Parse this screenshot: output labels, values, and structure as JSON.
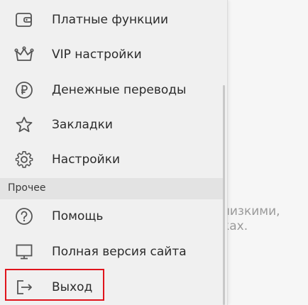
{
  "menu": {
    "items": [
      {
        "label": "Платные функции",
        "icon": "wallet-icon"
      },
      {
        "label": "VIP настройки",
        "icon": "crown-icon"
      },
      {
        "label": "Денежные переводы",
        "icon": "ruble-icon"
      },
      {
        "label": "Закладки",
        "icon": "star-icon"
      },
      {
        "label": "Настройки",
        "icon": "gear-icon"
      }
    ],
    "section_other": "Прочее",
    "other_items": [
      {
        "label": "Помощь",
        "icon": "help-icon"
      },
      {
        "label": "Полная версия сайта",
        "icon": "monitor-icon"
      },
      {
        "label": "Выход",
        "icon": "logout-icon"
      }
    ]
  },
  "background": {
    "partial_text": "лизкими,\nках."
  },
  "colors": {
    "highlight": "#e0141c",
    "icon": "#555555",
    "text": "#2b2b2b"
  }
}
